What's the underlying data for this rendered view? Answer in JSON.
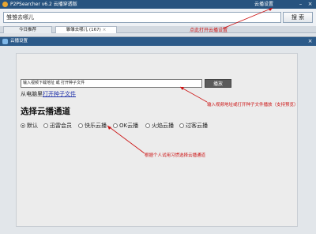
{
  "window": {
    "title": "P2PSearcher v6.2 云播穿透版",
    "cloud_settings": "云播设置",
    "minimize": "–",
    "close": "×"
  },
  "search": {
    "value": "雏雏去哪儿",
    "button_label": "搜 索"
  },
  "tabs": [
    {
      "label": "今日推荐"
    },
    {
      "label": "雏雏去哪儿 (167)",
      "close": "×"
    }
  ],
  "annotations": {
    "cloud_settings_hint": "点此打开云播设置",
    "input_hint": "输入视频地址或打开种子文件播放（支持预览）",
    "channel_hint": "根据个人试用习惯选择云播通道"
  },
  "dialog": {
    "title": "云播设置",
    "close": "×",
    "url_input_value": "输入视频下载地址  或  打开种子文件",
    "play_button": "播放",
    "local_prefix": "从电脑里",
    "local_link": "打开种子文件",
    "channel_heading": "选择云播通道",
    "channels": [
      {
        "label": "默认",
        "checked": true
      },
      {
        "label": "迅雷会员",
        "checked": false
      },
      {
        "label": "快乐云播",
        "checked": false
      },
      {
        "label": "OK云播",
        "checked": false
      },
      {
        "label": "火焰云播",
        "checked": false
      },
      {
        "label": "过客云播",
        "checked": false
      }
    ]
  },
  "colors": {
    "titlebar": "#27537f",
    "annotation": "#cc1111",
    "link": "#2233aa"
  }
}
